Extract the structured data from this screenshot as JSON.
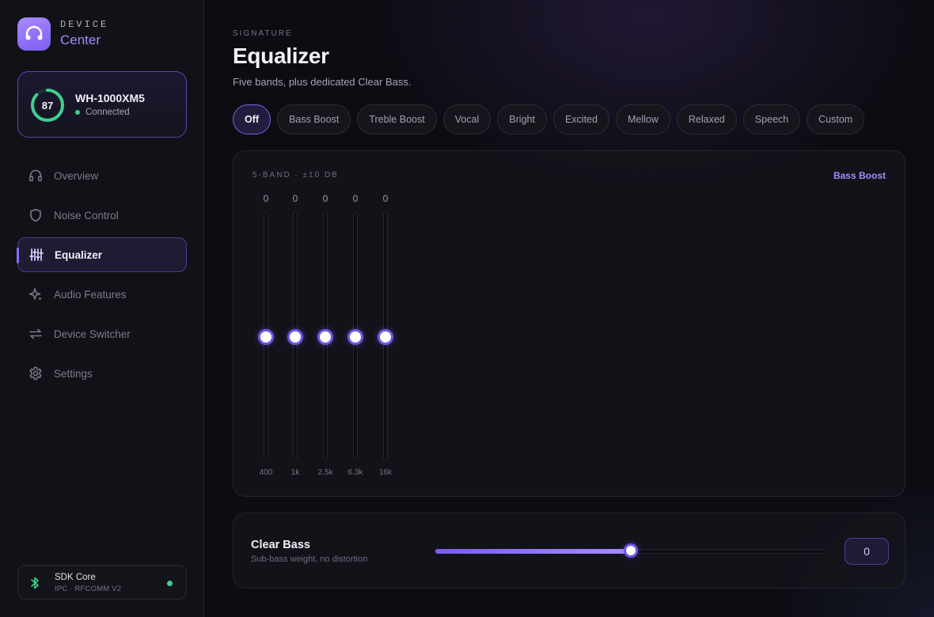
{
  "brand": {
    "top": "DEVICE",
    "bottom": "Center",
    "icon": "headphones-icon"
  },
  "device": {
    "battery": 87,
    "battery_label": "87",
    "name": "WH-1000XM5",
    "status": "Connected",
    "status_color": "#3fcf8e"
  },
  "nav": {
    "items": [
      {
        "label": "Overview",
        "icon": "headphones-icon",
        "active": false
      },
      {
        "label": "Noise Control",
        "icon": "shield-icon",
        "active": false
      },
      {
        "label": "Equalizer",
        "icon": "equalizer-icon",
        "active": true
      },
      {
        "label": "Audio Features",
        "icon": "sparkle-icon",
        "active": false
      },
      {
        "label": "Device Switcher",
        "icon": "swap-arrows-icon",
        "active": false
      },
      {
        "label": "Settings",
        "icon": "gear-icon",
        "active": false
      }
    ]
  },
  "sdk": {
    "title": "SDK Core",
    "subtitle": "IPC · RFCOMM V2",
    "icon": "bluetooth-icon"
  },
  "header": {
    "eyebrow": "SIGNATURE",
    "title": "Equalizer",
    "subtitle": "Five bands, plus dedicated Clear Bass."
  },
  "presets": [
    {
      "label": "Off",
      "active": true
    },
    {
      "label": "Bass Boost",
      "active": false
    },
    {
      "label": "Treble Boost",
      "active": false
    },
    {
      "label": "Vocal",
      "active": false
    },
    {
      "label": "Bright",
      "active": false
    },
    {
      "label": "Excited",
      "active": false
    },
    {
      "label": "Mellow",
      "active": false
    },
    {
      "label": "Relaxed",
      "active": false
    },
    {
      "label": "Speech",
      "active": false
    },
    {
      "label": "Custom",
      "active": false
    }
  ],
  "eq": {
    "caption": "5-BAND · ±10 DB",
    "badge": "Bass Boost",
    "range": [
      -10,
      10
    ],
    "bands": [
      {
        "label": "400",
        "value": 0,
        "value_label": "0"
      },
      {
        "label": "1k",
        "value": 0,
        "value_label": "0"
      },
      {
        "label": "2.5k",
        "value": 0,
        "value_label": "0"
      },
      {
        "label": "6.3k",
        "value": 0,
        "value_label": "0"
      },
      {
        "label": "16k",
        "value": 0,
        "value_label": "0"
      }
    ]
  },
  "clear_bass": {
    "title": "Clear Bass",
    "subtitle": "Sub-bass weight, no distortion",
    "value": 0,
    "value_label": "0",
    "range": [
      -10,
      10
    ]
  },
  "colors": {
    "accent": "#8a6cff",
    "accent_dark": "#6e57e8",
    "battery_ring": "#3fcf8e"
  }
}
